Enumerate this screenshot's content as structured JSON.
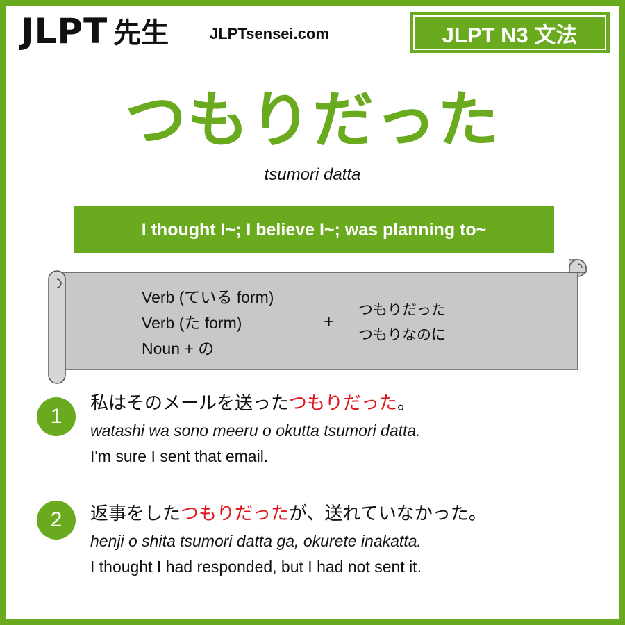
{
  "header": {
    "logo_text": "JLPT",
    "logo_sensei": "先生",
    "site": "JLPTsensei.com",
    "badge": "JLPT N3 文法"
  },
  "grammar": {
    "title": "つもりだった",
    "romaji": "tsumori datta",
    "meaning": "I thought I~; I believe I~; was planning to~"
  },
  "formation": {
    "left": [
      "Verb (ている form)",
      "Verb (た form)",
      "Noun + の"
    ],
    "plus": "+",
    "right": [
      "つもりだった",
      "つもりなのに"
    ]
  },
  "examples": [
    {
      "number": "1",
      "jp_before": "私はそのメールを送った",
      "jp_highlight": "つもりだった",
      "jp_after": "。",
      "romaji": "watashi wa sono meeru o okutta tsumori datta.",
      "english": "I'm sure I sent that email."
    },
    {
      "number": "2",
      "jp_before": "返事をした",
      "jp_highlight": "つもりだった",
      "jp_after": "が、送れていなかった。",
      "romaji": "henji o shita tsumori datta ga, okurete inakatta.",
      "english": "I thought I had responded, but I had not sent it."
    }
  ],
  "colors": {
    "accent": "#6aaa1e",
    "highlight": "#e0161c",
    "scroll": "#c8c8c8"
  }
}
